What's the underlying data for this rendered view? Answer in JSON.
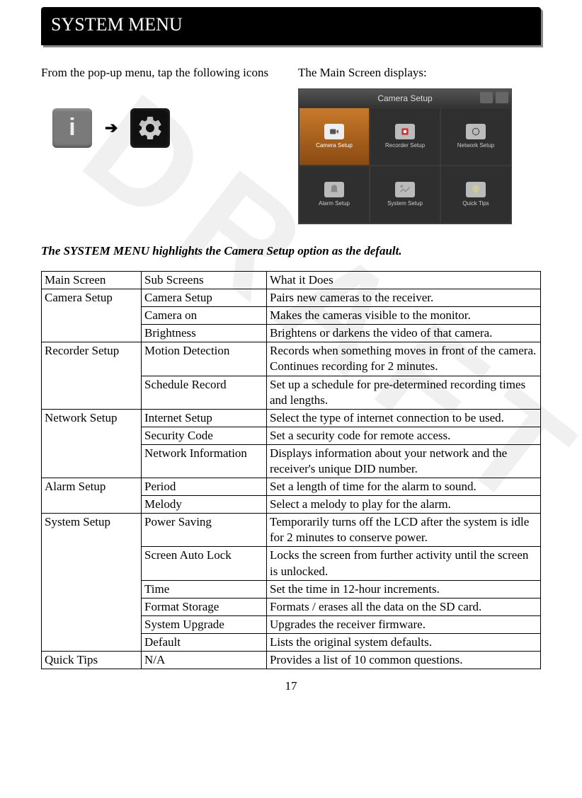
{
  "title": "SYSTEM MENU",
  "intro_left": "From the pop-up menu, tap the following icons",
  "intro_right": "The Main Screen displays:",
  "arrow": "➔",
  "highlight_note": "The SYSTEM MENU highlights the Camera Setup option as the default.",
  "main_screen": {
    "header": "Camera Setup",
    "cells": [
      {
        "label": "Camera Setup",
        "selected": true
      },
      {
        "label": "Recorder Setup",
        "selected": false
      },
      {
        "label": "Network Setup",
        "selected": false
      },
      {
        "label": "Alarm Setup",
        "selected": false
      },
      {
        "label": "System Setup",
        "selected": false
      },
      {
        "label": "Quick Tips",
        "selected": false
      }
    ]
  },
  "table": {
    "headers": [
      "Main Screen",
      "Sub Screens",
      "What it Does"
    ],
    "groups": [
      {
        "main": "Camera Setup",
        "rows": [
          {
            "sub": "Camera Setup",
            "desc": "Pairs new cameras to the receiver."
          },
          {
            "sub": "Camera on",
            "desc": "Makes the cameras visible to the monitor."
          },
          {
            "sub": "Brightness",
            "desc": "Brightens or darkens the video of that camera."
          }
        ]
      },
      {
        "main": "Recorder Setup",
        "rows": [
          {
            "sub": "Motion Detection",
            "desc": "Records when something moves in front of the camera. Continues recording for 2 minutes."
          },
          {
            "sub": "Schedule Record",
            "desc": "Set up a schedule for pre-determined recording times and lengths."
          }
        ]
      },
      {
        "main": "Network Setup",
        "rows": [
          {
            "sub": "Internet Setup",
            "desc": "Select the type of internet connection to be used."
          },
          {
            "sub": "Security Code",
            "desc": "Set a security code for remote access."
          },
          {
            "sub": "Network Information",
            "desc": "Displays information about your network and the receiver's unique DID number."
          }
        ]
      },
      {
        "main": "Alarm Setup",
        "rows": [
          {
            "sub": "Period",
            "desc": "Set a length of time for the alarm to sound."
          },
          {
            "sub": "Melody",
            "desc": "Select a melody to play for the alarm."
          }
        ]
      },
      {
        "main": "System Setup",
        "rows": [
          {
            "sub": "Power Saving",
            "desc": "Temporarily turns off the LCD after the system is idle for 2 minutes to conserve power."
          },
          {
            "sub": "Screen Auto Lock",
            "desc": "Locks the screen from further activity until the screen is unlocked."
          },
          {
            "sub": "Time",
            "desc": "Set the time in 12-hour increments."
          },
          {
            "sub": "Format Storage",
            "desc": "Formats / erases all the data on the SD card."
          },
          {
            "sub": "System Upgrade",
            "desc": "Upgrades the receiver firmware."
          },
          {
            "sub": "Default",
            "desc": "Lists the original system defaults."
          }
        ]
      },
      {
        "main": "Quick Tips",
        "rows": [
          {
            "sub": "N/A",
            "desc": "Provides a list of 10 common questions."
          }
        ]
      }
    ]
  },
  "page_number": "17",
  "watermark": "DRAFT"
}
